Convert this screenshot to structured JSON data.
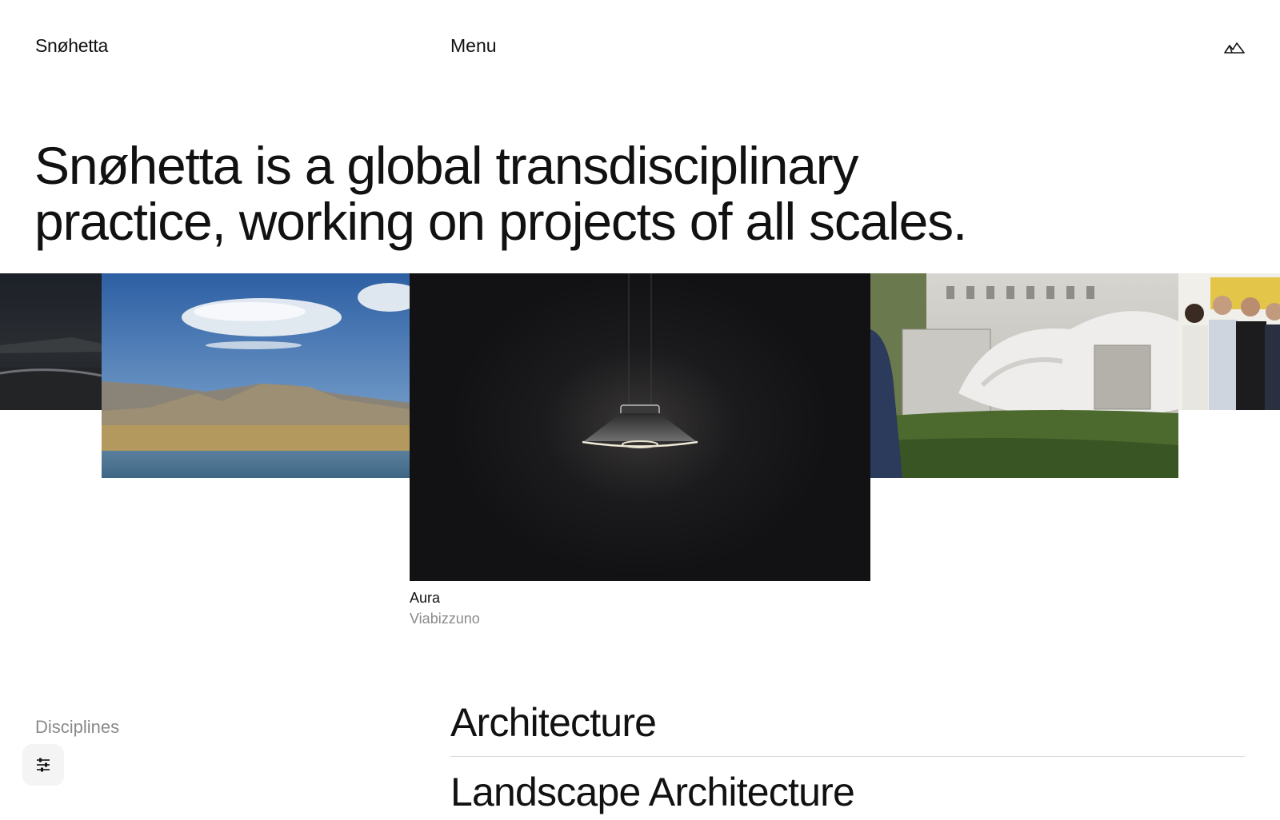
{
  "header": {
    "logo": "Snøhetta",
    "menu_label": "Menu",
    "icon": "mountain-logo-icon"
  },
  "hero": {
    "line1": "Snøhetta is a global transdisciplinary",
    "line2": "practice, working on projects of all scales."
  },
  "carousel": {
    "active_caption": {
      "title": "Aura",
      "subtitle": "Viabizzuno"
    }
  },
  "disciplines": {
    "label": "Disciplines",
    "items": [
      "Architecture",
      "Landscape Architecture"
    ]
  },
  "filter_button": {
    "icon": "sliders-icon"
  },
  "colors": {
    "text": "#111111",
    "muted": "#8a8a8a",
    "divider": "#d9d9d9",
    "background": "#ffffff"
  }
}
